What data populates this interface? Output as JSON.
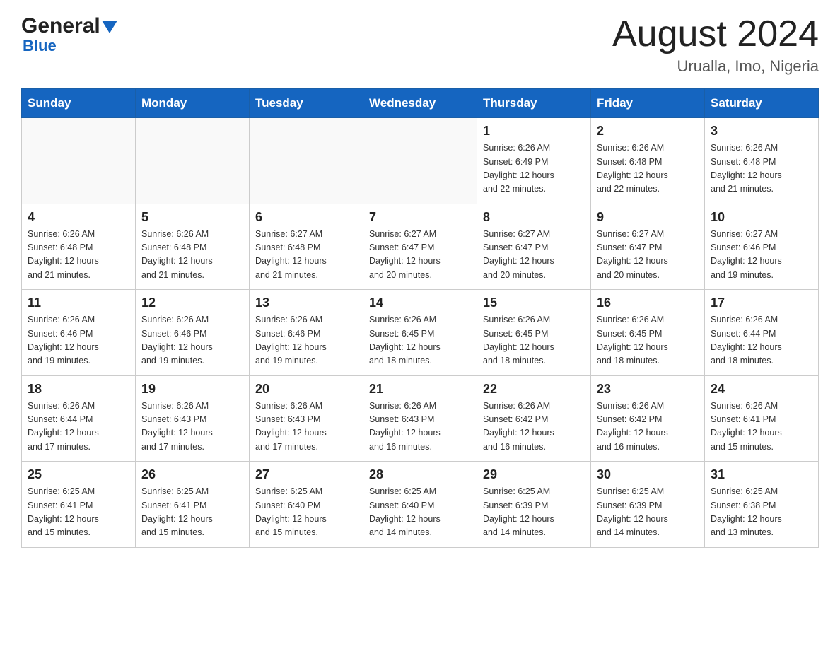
{
  "header": {
    "logo_general": "General",
    "logo_blue": "Blue",
    "title": "August 2024",
    "subtitle": "Urualla, Imo, Nigeria"
  },
  "calendar": {
    "days_of_week": [
      "Sunday",
      "Monday",
      "Tuesday",
      "Wednesday",
      "Thursday",
      "Friday",
      "Saturday"
    ],
    "weeks": [
      [
        {
          "day": "",
          "info": ""
        },
        {
          "day": "",
          "info": ""
        },
        {
          "day": "",
          "info": ""
        },
        {
          "day": "",
          "info": ""
        },
        {
          "day": "1",
          "info": "Sunrise: 6:26 AM\nSunset: 6:49 PM\nDaylight: 12 hours\nand 22 minutes."
        },
        {
          "day": "2",
          "info": "Sunrise: 6:26 AM\nSunset: 6:48 PM\nDaylight: 12 hours\nand 22 minutes."
        },
        {
          "day": "3",
          "info": "Sunrise: 6:26 AM\nSunset: 6:48 PM\nDaylight: 12 hours\nand 21 minutes."
        }
      ],
      [
        {
          "day": "4",
          "info": "Sunrise: 6:26 AM\nSunset: 6:48 PM\nDaylight: 12 hours\nand 21 minutes."
        },
        {
          "day": "5",
          "info": "Sunrise: 6:26 AM\nSunset: 6:48 PM\nDaylight: 12 hours\nand 21 minutes."
        },
        {
          "day": "6",
          "info": "Sunrise: 6:27 AM\nSunset: 6:48 PM\nDaylight: 12 hours\nand 21 minutes."
        },
        {
          "day": "7",
          "info": "Sunrise: 6:27 AM\nSunset: 6:47 PM\nDaylight: 12 hours\nand 20 minutes."
        },
        {
          "day": "8",
          "info": "Sunrise: 6:27 AM\nSunset: 6:47 PM\nDaylight: 12 hours\nand 20 minutes."
        },
        {
          "day": "9",
          "info": "Sunrise: 6:27 AM\nSunset: 6:47 PM\nDaylight: 12 hours\nand 20 minutes."
        },
        {
          "day": "10",
          "info": "Sunrise: 6:27 AM\nSunset: 6:46 PM\nDaylight: 12 hours\nand 19 minutes."
        }
      ],
      [
        {
          "day": "11",
          "info": "Sunrise: 6:26 AM\nSunset: 6:46 PM\nDaylight: 12 hours\nand 19 minutes."
        },
        {
          "day": "12",
          "info": "Sunrise: 6:26 AM\nSunset: 6:46 PM\nDaylight: 12 hours\nand 19 minutes."
        },
        {
          "day": "13",
          "info": "Sunrise: 6:26 AM\nSunset: 6:46 PM\nDaylight: 12 hours\nand 19 minutes."
        },
        {
          "day": "14",
          "info": "Sunrise: 6:26 AM\nSunset: 6:45 PM\nDaylight: 12 hours\nand 18 minutes."
        },
        {
          "day": "15",
          "info": "Sunrise: 6:26 AM\nSunset: 6:45 PM\nDaylight: 12 hours\nand 18 minutes."
        },
        {
          "day": "16",
          "info": "Sunrise: 6:26 AM\nSunset: 6:45 PM\nDaylight: 12 hours\nand 18 minutes."
        },
        {
          "day": "17",
          "info": "Sunrise: 6:26 AM\nSunset: 6:44 PM\nDaylight: 12 hours\nand 18 minutes."
        }
      ],
      [
        {
          "day": "18",
          "info": "Sunrise: 6:26 AM\nSunset: 6:44 PM\nDaylight: 12 hours\nand 17 minutes."
        },
        {
          "day": "19",
          "info": "Sunrise: 6:26 AM\nSunset: 6:43 PM\nDaylight: 12 hours\nand 17 minutes."
        },
        {
          "day": "20",
          "info": "Sunrise: 6:26 AM\nSunset: 6:43 PM\nDaylight: 12 hours\nand 17 minutes."
        },
        {
          "day": "21",
          "info": "Sunrise: 6:26 AM\nSunset: 6:43 PM\nDaylight: 12 hours\nand 16 minutes."
        },
        {
          "day": "22",
          "info": "Sunrise: 6:26 AM\nSunset: 6:42 PM\nDaylight: 12 hours\nand 16 minutes."
        },
        {
          "day": "23",
          "info": "Sunrise: 6:26 AM\nSunset: 6:42 PM\nDaylight: 12 hours\nand 16 minutes."
        },
        {
          "day": "24",
          "info": "Sunrise: 6:26 AM\nSunset: 6:41 PM\nDaylight: 12 hours\nand 15 minutes."
        }
      ],
      [
        {
          "day": "25",
          "info": "Sunrise: 6:25 AM\nSunset: 6:41 PM\nDaylight: 12 hours\nand 15 minutes."
        },
        {
          "day": "26",
          "info": "Sunrise: 6:25 AM\nSunset: 6:41 PM\nDaylight: 12 hours\nand 15 minutes."
        },
        {
          "day": "27",
          "info": "Sunrise: 6:25 AM\nSunset: 6:40 PM\nDaylight: 12 hours\nand 15 minutes."
        },
        {
          "day": "28",
          "info": "Sunrise: 6:25 AM\nSunset: 6:40 PM\nDaylight: 12 hours\nand 14 minutes."
        },
        {
          "day": "29",
          "info": "Sunrise: 6:25 AM\nSunset: 6:39 PM\nDaylight: 12 hours\nand 14 minutes."
        },
        {
          "day": "30",
          "info": "Sunrise: 6:25 AM\nSunset: 6:39 PM\nDaylight: 12 hours\nand 14 minutes."
        },
        {
          "day": "31",
          "info": "Sunrise: 6:25 AM\nSunset: 6:38 PM\nDaylight: 12 hours\nand 13 minutes."
        }
      ]
    ]
  }
}
